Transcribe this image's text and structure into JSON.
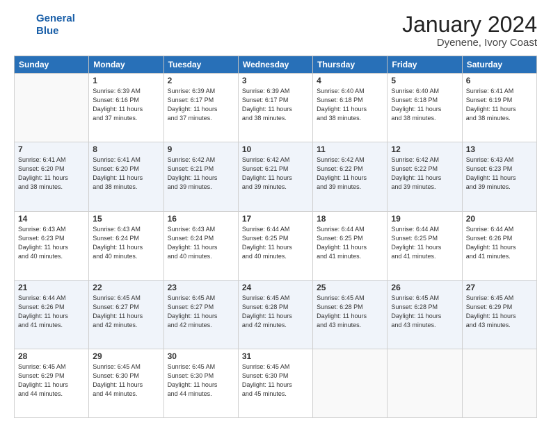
{
  "logo": {
    "line1": "General",
    "line2": "Blue"
  },
  "title": "January 2024",
  "location": "Dyenene, Ivory Coast",
  "days_of_week": [
    "Sunday",
    "Monday",
    "Tuesday",
    "Wednesday",
    "Thursday",
    "Friday",
    "Saturday"
  ],
  "weeks": [
    [
      {
        "day": "",
        "info": ""
      },
      {
        "day": "1",
        "info": "Sunrise: 6:39 AM\nSunset: 6:16 PM\nDaylight: 11 hours\nand 37 minutes."
      },
      {
        "day": "2",
        "info": "Sunrise: 6:39 AM\nSunset: 6:17 PM\nDaylight: 11 hours\nand 37 minutes."
      },
      {
        "day": "3",
        "info": "Sunrise: 6:39 AM\nSunset: 6:17 PM\nDaylight: 11 hours\nand 38 minutes."
      },
      {
        "day": "4",
        "info": "Sunrise: 6:40 AM\nSunset: 6:18 PM\nDaylight: 11 hours\nand 38 minutes."
      },
      {
        "day": "5",
        "info": "Sunrise: 6:40 AM\nSunset: 6:18 PM\nDaylight: 11 hours\nand 38 minutes."
      },
      {
        "day": "6",
        "info": "Sunrise: 6:41 AM\nSunset: 6:19 PM\nDaylight: 11 hours\nand 38 minutes."
      }
    ],
    [
      {
        "day": "7",
        "info": "Sunrise: 6:41 AM\nSunset: 6:20 PM\nDaylight: 11 hours\nand 38 minutes."
      },
      {
        "day": "8",
        "info": "Sunrise: 6:41 AM\nSunset: 6:20 PM\nDaylight: 11 hours\nand 38 minutes."
      },
      {
        "day": "9",
        "info": "Sunrise: 6:42 AM\nSunset: 6:21 PM\nDaylight: 11 hours\nand 39 minutes."
      },
      {
        "day": "10",
        "info": "Sunrise: 6:42 AM\nSunset: 6:21 PM\nDaylight: 11 hours\nand 39 minutes."
      },
      {
        "day": "11",
        "info": "Sunrise: 6:42 AM\nSunset: 6:22 PM\nDaylight: 11 hours\nand 39 minutes."
      },
      {
        "day": "12",
        "info": "Sunrise: 6:42 AM\nSunset: 6:22 PM\nDaylight: 11 hours\nand 39 minutes."
      },
      {
        "day": "13",
        "info": "Sunrise: 6:43 AM\nSunset: 6:23 PM\nDaylight: 11 hours\nand 39 minutes."
      }
    ],
    [
      {
        "day": "14",
        "info": "Sunrise: 6:43 AM\nSunset: 6:23 PM\nDaylight: 11 hours\nand 40 minutes."
      },
      {
        "day": "15",
        "info": "Sunrise: 6:43 AM\nSunset: 6:24 PM\nDaylight: 11 hours\nand 40 minutes."
      },
      {
        "day": "16",
        "info": "Sunrise: 6:43 AM\nSunset: 6:24 PM\nDaylight: 11 hours\nand 40 minutes."
      },
      {
        "day": "17",
        "info": "Sunrise: 6:44 AM\nSunset: 6:25 PM\nDaylight: 11 hours\nand 40 minutes."
      },
      {
        "day": "18",
        "info": "Sunrise: 6:44 AM\nSunset: 6:25 PM\nDaylight: 11 hours\nand 41 minutes."
      },
      {
        "day": "19",
        "info": "Sunrise: 6:44 AM\nSunset: 6:25 PM\nDaylight: 11 hours\nand 41 minutes."
      },
      {
        "day": "20",
        "info": "Sunrise: 6:44 AM\nSunset: 6:26 PM\nDaylight: 11 hours\nand 41 minutes."
      }
    ],
    [
      {
        "day": "21",
        "info": "Sunrise: 6:44 AM\nSunset: 6:26 PM\nDaylight: 11 hours\nand 41 minutes."
      },
      {
        "day": "22",
        "info": "Sunrise: 6:45 AM\nSunset: 6:27 PM\nDaylight: 11 hours\nand 42 minutes."
      },
      {
        "day": "23",
        "info": "Sunrise: 6:45 AM\nSunset: 6:27 PM\nDaylight: 11 hours\nand 42 minutes."
      },
      {
        "day": "24",
        "info": "Sunrise: 6:45 AM\nSunset: 6:28 PM\nDaylight: 11 hours\nand 42 minutes."
      },
      {
        "day": "25",
        "info": "Sunrise: 6:45 AM\nSunset: 6:28 PM\nDaylight: 11 hours\nand 43 minutes."
      },
      {
        "day": "26",
        "info": "Sunrise: 6:45 AM\nSunset: 6:28 PM\nDaylight: 11 hours\nand 43 minutes."
      },
      {
        "day": "27",
        "info": "Sunrise: 6:45 AM\nSunset: 6:29 PM\nDaylight: 11 hours\nand 43 minutes."
      }
    ],
    [
      {
        "day": "28",
        "info": "Sunrise: 6:45 AM\nSunset: 6:29 PM\nDaylight: 11 hours\nand 44 minutes."
      },
      {
        "day": "29",
        "info": "Sunrise: 6:45 AM\nSunset: 6:30 PM\nDaylight: 11 hours\nand 44 minutes."
      },
      {
        "day": "30",
        "info": "Sunrise: 6:45 AM\nSunset: 6:30 PM\nDaylight: 11 hours\nand 44 minutes."
      },
      {
        "day": "31",
        "info": "Sunrise: 6:45 AM\nSunset: 6:30 PM\nDaylight: 11 hours\nand 45 minutes."
      },
      {
        "day": "",
        "info": ""
      },
      {
        "day": "",
        "info": ""
      },
      {
        "day": "",
        "info": ""
      }
    ]
  ]
}
